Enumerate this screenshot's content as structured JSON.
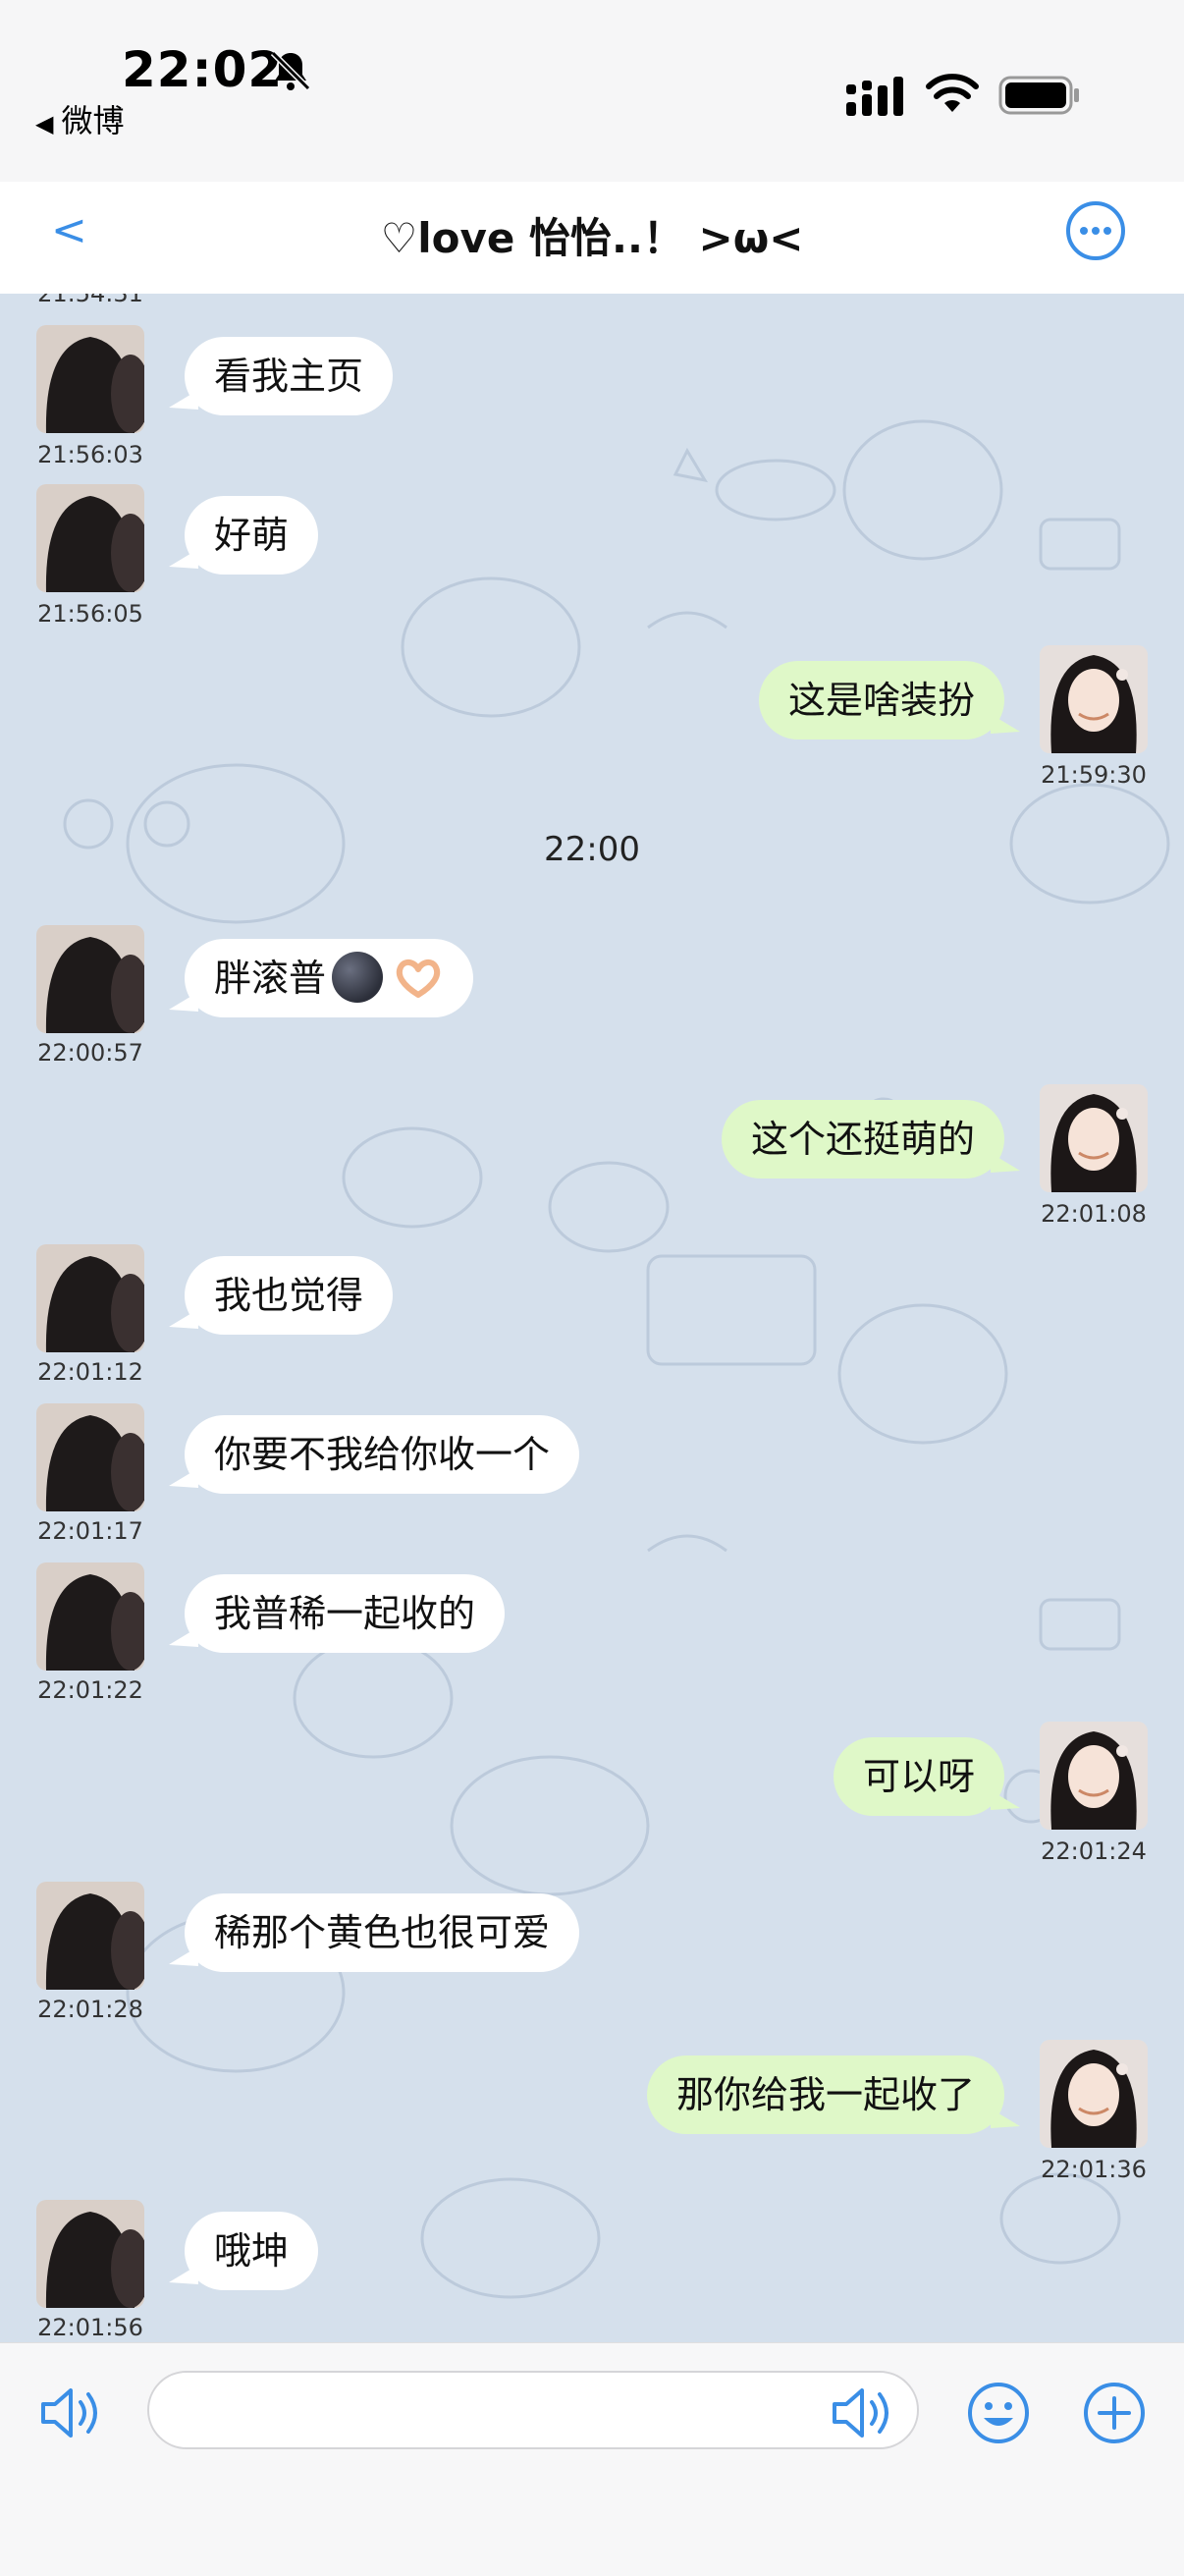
{
  "status_bar": {
    "time": "22:02",
    "back_app": "微博"
  },
  "header": {
    "back": "<",
    "title": "♡love 怡怡..！ >ω<"
  },
  "chat": {
    "cut_timestamp": "21:54:31",
    "divider_time": "22:00",
    "messages": [
      {
        "side": "in",
        "text": "看我主页",
        "time": "21:56:03"
      },
      {
        "side": "in",
        "text": "好萌",
        "time": "21:56:05"
      },
      {
        "side": "out",
        "text": "这是啥装扮",
        "time": "21:59:30"
      },
      {
        "side": "in",
        "text": "胖滚普",
        "time": "22:00:57"
      },
      {
        "side": "out",
        "text": "这个还挺萌的",
        "time": "22:01:08"
      },
      {
        "side": "in",
        "text": "我也觉得",
        "time": "22:01:12"
      },
      {
        "side": "in",
        "text": "你要不我给你收一个",
        "time": "22:01:17"
      },
      {
        "side": "in",
        "text": "我普稀一起收的",
        "time": "22:01:22"
      },
      {
        "side": "out",
        "text": "可以呀",
        "time": "22:01:24"
      },
      {
        "side": "in",
        "text": "稀那个黄色也很可爱",
        "time": "22:01:28"
      },
      {
        "side": "out",
        "text": "那你给我一起收了",
        "time": "22:01:36"
      },
      {
        "side": "in",
        "text": "哦坤",
        "time": "22:01:56"
      }
    ]
  },
  "input": {
    "value": "",
    "placeholder": ""
  },
  "colors": {
    "chat_background": "#d5e0ec",
    "incoming_bubble": "#ffffff",
    "outgoing_bubble": "#dff8c8",
    "accent": "#3a8ee6"
  },
  "icons": [
    "bell-slash-icon",
    "signal-icon",
    "wifi-icon",
    "battery-icon",
    "more-icon",
    "voice-icon",
    "emoji-icon",
    "plus-icon",
    "moon-emoji-icon",
    "heart-hands-emoji-icon"
  ]
}
